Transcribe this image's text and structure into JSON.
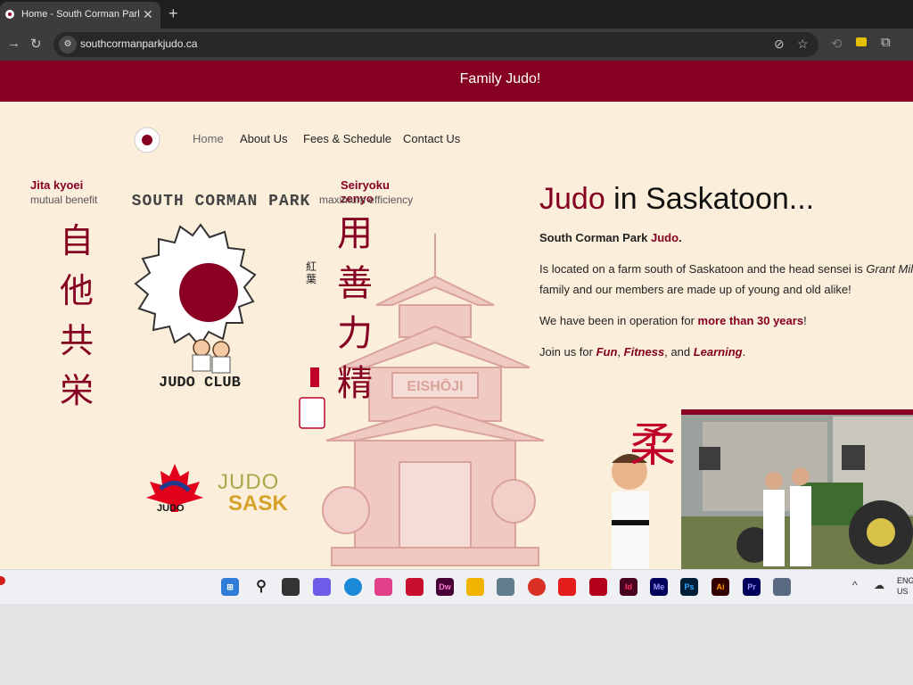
{
  "browser": {
    "tab_title": "Home - South Corman Park Judo Club",
    "url": "southcormanparkjudo.ca"
  },
  "site": {
    "banner": "Family Judo!",
    "nav": [
      "Home",
      "About Us",
      "Fees & Schedule",
      "Contact Us"
    ],
    "logo_small_text": [
      "SOUTH CORMAN PARK",
      "JUDO CLUB"
    ],
    "crest": {
      "left_title": "Jita kyoei",
      "left_sub": "mutual benefit",
      "right_title": "Seiryoku zenyo",
      "right_sub": "maximum efficiency",
      "arc_text": "SOUTH CORMAN PARK",
      "club_text": "JUDO CLUB",
      "left_kanji": [
        "自",
        "他",
        "共",
        "栄"
      ],
      "right_kanji": [
        "精",
        "力",
        "善",
        "用"
      ],
      "seal_top": [
        "紅",
        "葉"
      ],
      "pagoda_sign": "EISHŌJI"
    },
    "hero": {
      "heading_red": "Judo",
      "heading_rest": " in Saskatoon...",
      "p1_plain": "South Corman Park ",
      "p1_red": "Judo",
      "p1_end": ".",
      "p2_a": "Is located on a farm south of Saskatoon and the head sensei is ",
      "p2_name": "Grant Mil",
      "p2_b": "family and our members are made up of young and old alike!",
      "p3_a": "We have been in operation for ",
      "p3_b": "more than 30 years",
      "p3_c": "!",
      "p4_a": "Join us for ",
      "p4_fun": "Fun",
      "p4_sep1": ", ",
      "p4_fit": "Fitness",
      "p4_sep2": ", and ",
      "p4_learn": "Learning",
      "p4_end": "."
    },
    "logos": {
      "judo_canada": "JUDO",
      "judo_sask_top": "JUDO",
      "judo_sask_bottom": "SASK"
    },
    "photo_kanji": "柔"
  },
  "taskbar": {
    "apps": [
      "Dw",
      "Id",
      "Me",
      "Ps",
      "Ai",
      "Pr"
    ],
    "lang": [
      "ENG",
      "US"
    ]
  },
  "colors": {
    "brand": "#860021",
    "page_bg": "#fbeedb"
  }
}
